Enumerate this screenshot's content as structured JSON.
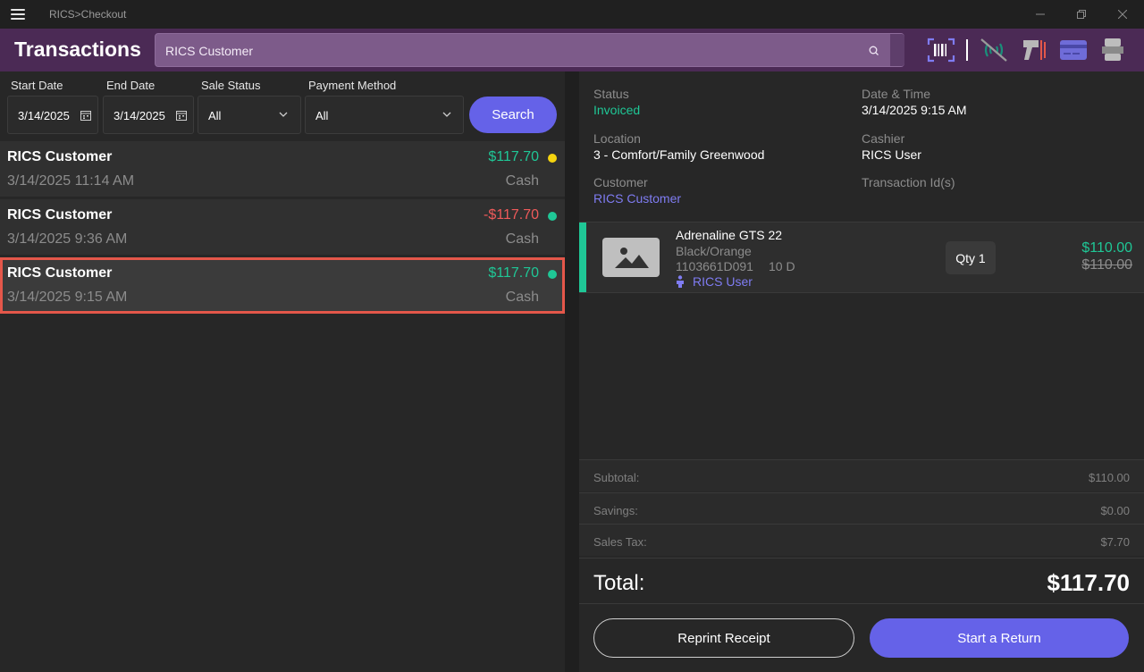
{
  "window": {
    "title": "RICS>Checkout"
  },
  "header": {
    "title": "Transactions",
    "search_value": "RICS Customer",
    "icons": [
      "barcode-scanner-icon",
      "nfc-off-icon",
      "hand-scanner-icon",
      "credit-card-icon",
      "printer-icon"
    ]
  },
  "filters": {
    "start_date_label": "Start Date",
    "start_date_value": "3/14/2025",
    "end_date_label": "End Date",
    "end_date_value": "3/14/2025",
    "sale_status_label": "Sale Status",
    "sale_status_value": "All",
    "payment_method_label": "Payment Method",
    "payment_method_value": "All",
    "search_button": "Search"
  },
  "transactions": [
    {
      "name": "RICS Customer",
      "datetime": "3/14/2025 11:14 AM",
      "amount": "$117.70",
      "method": "Cash",
      "dot_color": "#f5d40f",
      "negative": false,
      "selected": false
    },
    {
      "name": "RICS Customer",
      "datetime": "3/14/2025 9:36 AM",
      "amount": "-$117.70",
      "method": "Cash",
      "dot_color": "#1fc796",
      "negative": true,
      "selected": false
    },
    {
      "name": "RICS Customer",
      "datetime": "3/14/2025 9:15 AM",
      "amount": "$117.70",
      "method": "Cash",
      "dot_color": "#1fc796",
      "negative": false,
      "selected": true
    }
  ],
  "details": {
    "status_label": "Status",
    "status_value": "Invoiced",
    "datetime_label": "Date & Time",
    "datetime_value": "3/14/2025 9:15 AM",
    "location_label": "Location",
    "location_value": "3 - Comfort/Family Greenwood",
    "cashier_label": "Cashier",
    "cashier_value": "RICS User",
    "customer_label": "Customer",
    "customer_value": "RICS Customer",
    "transaction_ids_label": "Transaction Id(s)"
  },
  "item": {
    "name": "Adrenaline GTS 22",
    "color": "Black/Orange",
    "sku": "1103661D091",
    "size": "10  D",
    "user": "RICS User",
    "qty": "Qty 1",
    "price": "$110.00",
    "original_price": "$110.00"
  },
  "totals": {
    "subtotal_label": "Subtotal:",
    "subtotal_value": "$110.00",
    "savings_label": "Savings:",
    "savings_value": "$0.00",
    "tax_label": "Sales Tax:",
    "tax_value": "$7.70",
    "total_label": "Total:",
    "total_value": "$117.70"
  },
  "actions": {
    "reprint_label": "Reprint Receipt",
    "return_label": "Start a Return"
  },
  "colors": {
    "accent": "#6562e8",
    "header": "#4b2a55",
    "positive": "#1fc796",
    "negative": "#ef5a5a",
    "selection": "#e4574a"
  }
}
